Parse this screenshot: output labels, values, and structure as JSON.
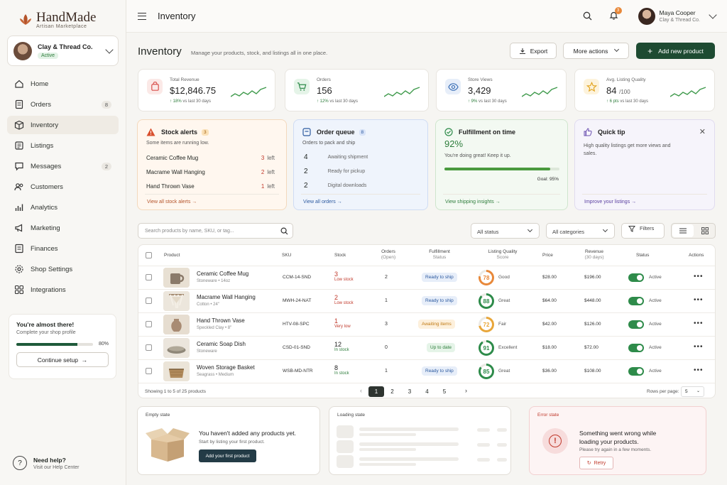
{
  "brand": {
    "name": "HandMade",
    "tagline": "Artisan Marketplace"
  },
  "shop": {
    "name": "Clay & Thread Co.",
    "status": "Active"
  },
  "nav": [
    {
      "label": "Home",
      "icon": "home-icon"
    },
    {
      "label": "Orders",
      "icon": "orders-icon",
      "count": "8"
    },
    {
      "label": "Inventory",
      "icon": "box-icon",
      "active": true
    },
    {
      "label": "Listings",
      "icon": "listings-icon"
    },
    {
      "label": "Messages",
      "icon": "messages-icon",
      "count": "2"
    },
    {
      "label": "Customers",
      "icon": "customers-icon"
    },
    {
      "label": "Analytics",
      "icon": "analytics-icon"
    },
    {
      "label": "Marketing",
      "icon": "megaphone-icon"
    },
    {
      "label": "Finances",
      "icon": "finances-icon"
    },
    {
      "label": "Shop Settings",
      "icon": "gear-icon"
    },
    {
      "label": "Integrations",
      "icon": "integrations-icon"
    }
  ],
  "profile": {
    "title": "You're almost there!",
    "subtitle": "Complete your shop profile",
    "progress": 0.8,
    "progress_label": "80%",
    "button": "Continue setup"
  },
  "help": {
    "title": "Need help?",
    "subtitle": "Visit our Help Center"
  },
  "topbar": {
    "title": "Inventory",
    "notif_count": "3",
    "user_name": "Maya Cooper",
    "user_shop": "Clay & Thread Co."
  },
  "page": {
    "title": "Inventory",
    "description": "Manage your products, stock, and listings all in one place.",
    "export": "Export",
    "more": "More actions",
    "add": "Add new product"
  },
  "stats": [
    {
      "label": "Total Revenue",
      "value": "$12,846.75",
      "change": "18%",
      "change_text": "vs last 30 days",
      "color": "#d9534f",
      "bg": "#fbe9e7"
    },
    {
      "label": "Orders",
      "value": "156",
      "change": "12%",
      "change_text": "vs last 30 days",
      "color": "#2e8b4a",
      "bg": "#e5f4e8"
    },
    {
      "label": "Store Views",
      "value": "3,429",
      "change": "9%",
      "change_text": "vs last 30 days",
      "color": "#3b6fb6",
      "bg": "#e7eef9"
    },
    {
      "label": "Avg. Listing Quality",
      "value": "84",
      "value_suffix": "/100",
      "change": "6 pts",
      "change_text": "vs last 30 days",
      "color": "#e2a21a",
      "bg": "#fdf3dc"
    }
  ],
  "stock_alerts": {
    "title": "Stock alerts",
    "count": "3",
    "subtitle": "Some items are running low.",
    "items": [
      {
        "name": "Ceramic Coffee Mug",
        "qty": "3",
        "unit": "left"
      },
      {
        "name": "Macrame Wall Hanging",
        "qty": "2",
        "unit": "left"
      },
      {
        "name": "Hand Thrown Vase",
        "qty": "1",
        "unit": "left"
      }
    ],
    "link": "View all stock alerts"
  },
  "order_queue": {
    "title": "Order queue",
    "count": "8",
    "subtitle": "Orders to pack and ship",
    "items": [
      {
        "n": "4",
        "label": "Awaiting shipment"
      },
      {
        "n": "2",
        "label": "Ready for pickup"
      },
      {
        "n": "2",
        "label": "Digital downloads"
      }
    ],
    "link": "View all orders"
  },
  "fulfillment": {
    "title": "Fulfillment on time",
    "value": "92%",
    "subtitle": "You're doing great! Keep it up.",
    "progress": 0.92,
    "goal": "Goal: 95%",
    "link": "View shipping insights"
  },
  "tip": {
    "title": "Quick tip",
    "text": "High quality listings get more views and sales.",
    "link": "Improve your listings"
  },
  "toolbar": {
    "search_placeholder": "Search products by name, SKU, or tag...",
    "status": "All status",
    "category": "All categories",
    "filters": "Filters"
  },
  "table": {
    "headers": {
      "product": "Product",
      "sku": "SKU",
      "stock": "Stock",
      "orders": "Orders",
      "orders_sub": "(Open)",
      "fulfillment": "Fulfillment",
      "fulfillment_sub": "Status",
      "quality": "Listing Quality",
      "quality_sub": "Score",
      "price": "Price",
      "revenue": "Revenue",
      "revenue_sub": "(30 days)",
      "status": "Status",
      "actions": "Actions"
    },
    "rows": [
      {
        "name": "Ceramic Coffee Mug",
        "meta": "Stoneware • 14oz",
        "sku": "CCM-14-SND",
        "stock": "3",
        "stock_label": "Low stock",
        "orders": "2",
        "fulfillment": "Ready to ship",
        "quality": "78",
        "quality_label": "Good",
        "price": "$28.00",
        "revenue": "$196.00",
        "status": "Active"
      },
      {
        "name": "Macrame Wall Hanging",
        "meta": "Cotton • 24\"",
        "sku": "MWH-24-NAT",
        "stock": "2",
        "stock_label": "Low stock",
        "orders": "1",
        "fulfillment": "Ready to ship",
        "quality": "88",
        "quality_label": "Great",
        "price": "$64.00",
        "revenue": "$448.00",
        "status": "Active"
      },
      {
        "name": "Hand Thrown Vase",
        "meta": "Speckled Clay • 8\"",
        "sku": "HTV-08-SPC",
        "stock": "1",
        "stock_label": "Very low",
        "orders": "3",
        "fulfillment": "Awaiting items",
        "quality": "72",
        "quality_label": "Fair",
        "price": "$42.00",
        "revenue": "$126.00",
        "status": "Active"
      },
      {
        "name": "Ceramic Soap Dish",
        "meta": "Stoneware",
        "sku": "CSD-01-SND",
        "stock": "12",
        "stock_label": "In stock",
        "orders": "0",
        "fulfillment": "Up to date",
        "quality": "91",
        "quality_label": "Excellent",
        "price": "$18.00",
        "revenue": "$72.00",
        "status": "Active"
      },
      {
        "name": "Woven Storage Basket",
        "meta": "Seagrass • Medium",
        "sku": "WSB-MD-NTR",
        "stock": "8",
        "stock_label": "In stock",
        "orders": "1",
        "fulfillment": "Ready to ship",
        "quality": "85",
        "quality_label": "Great",
        "price": "$36.00",
        "revenue": "$108.00",
        "status": "Active"
      }
    ],
    "showing": "Showing 1 to 5 of 25 products",
    "pages": [
      "1",
      "2",
      "3",
      "4",
      "5"
    ],
    "rows_per_page_label": "Rows per page:",
    "rows_per_page": "5"
  },
  "empty_state": {
    "label": "Empty state",
    "title": "You haven't added any products yet.",
    "subtitle": "Start by listing your first product.",
    "button": "Add your first product"
  },
  "loading_state": {
    "label": "Loading state"
  },
  "error_state": {
    "label": "Error state",
    "title": "Something went wrong while loading your products.",
    "subtitle": "Please try again in a few moments.",
    "button": "Retry"
  }
}
